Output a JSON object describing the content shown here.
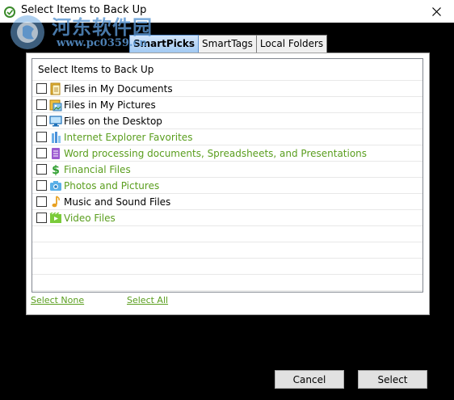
{
  "window": {
    "title": "Select Items to Back Up"
  },
  "watermark": {
    "text": "河东软件园",
    "url": "www.pc0359.cn"
  },
  "tabs": [
    {
      "label": "SmartPicks",
      "active": true
    },
    {
      "label": "SmartTags",
      "active": false
    },
    {
      "label": "Local Folders",
      "active": false
    }
  ],
  "list": {
    "header": "Select Items to Back Up",
    "items": [
      {
        "label": "Files in My Documents",
        "icon": "documents-icon",
        "color": "black",
        "checked": false
      },
      {
        "label": "Files in My Pictures",
        "icon": "pictures-icon",
        "color": "black",
        "checked": false
      },
      {
        "label": "Files on the Desktop",
        "icon": "desktop-icon",
        "color": "black",
        "checked": false
      },
      {
        "label": "Internet Explorer Favorites",
        "icon": "favorites-icon",
        "color": "green",
        "checked": false
      },
      {
        "label": "Word processing documents, Spreadsheets, and Presentations",
        "icon": "office-docs-icon",
        "color": "green",
        "checked": false
      },
      {
        "label": "Financial Files",
        "icon": "dollar-icon",
        "color": "green",
        "checked": false
      },
      {
        "label": "Photos and Pictures",
        "icon": "camera-icon",
        "color": "green",
        "checked": false
      },
      {
        "label": "Music and Sound Files",
        "icon": "music-note-icon",
        "color": "black",
        "checked": false
      },
      {
        "label": "Video Files",
        "icon": "video-icon",
        "color": "green",
        "checked": false
      }
    ]
  },
  "links": {
    "select_none": "Select None",
    "select_all": "Select All"
  },
  "buttons": {
    "cancel": "Cancel",
    "select": "Select"
  },
  "colors": {
    "green_text": "#5a9e1e",
    "tab_active": "#9fc8f2"
  }
}
